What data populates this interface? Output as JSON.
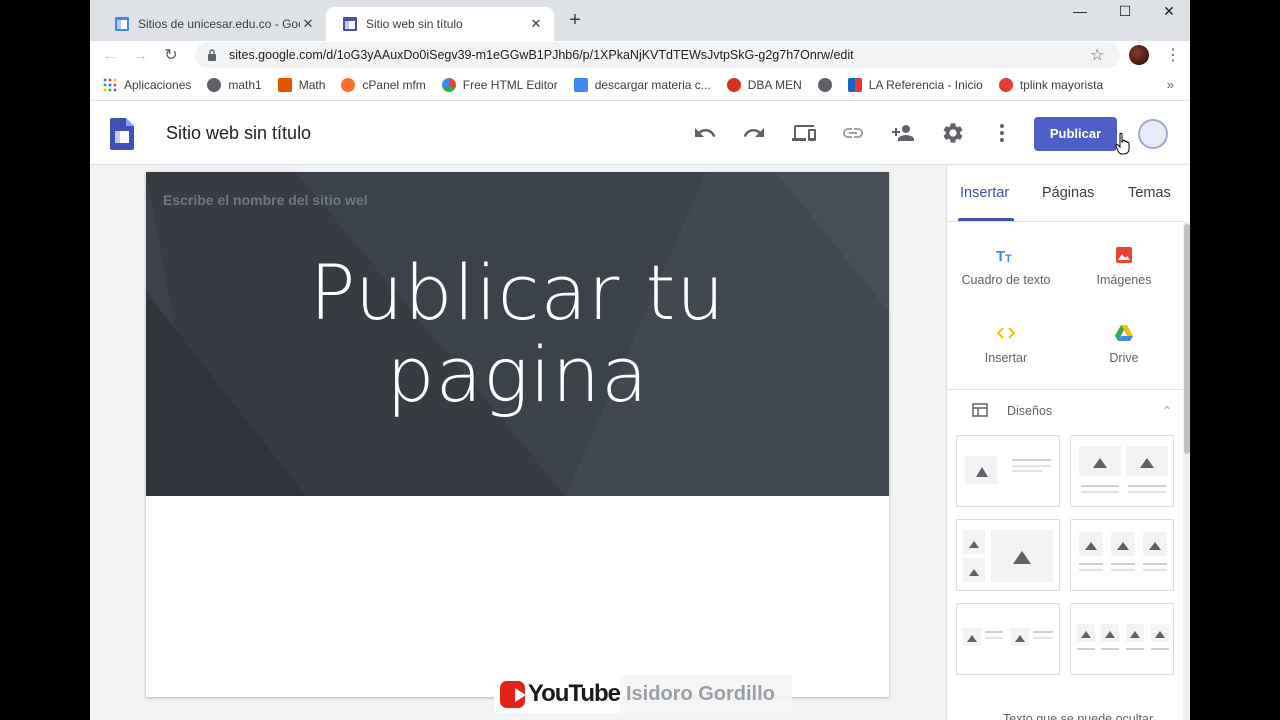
{
  "browser": {
    "tabs": [
      {
        "title": "Sitios de unicesar.edu.co - Goog",
        "active": false
      },
      {
        "title": "Sitio web sin título",
        "active": true
      }
    ],
    "new_tab": "+",
    "window_controls": {
      "minimize": "—",
      "maximize": "☐",
      "close": "✕"
    },
    "url": "sites.google.com/d/1oG3yAAuxDo0iSegv39-m1eGGwB1PJhb6/p/1XPkaNjKVTdTEWsJvtpSkG-g2g7h7Onrw/edit",
    "bookmarks": [
      {
        "label": "Aplicaciones",
        "color": "#1a73e8"
      },
      {
        "label": "math1",
        "color": "#5f6368"
      },
      {
        "label": "Math",
        "color": "#e65100"
      },
      {
        "label": "cPanel mfm",
        "color": "#ff6c2c"
      },
      {
        "label": "Free HTML Editor",
        "color": "#34a853"
      },
      {
        "label": "descargar materia c...",
        "color": "#4285f4"
      },
      {
        "label": "DBA MEN",
        "color": "#d93025"
      },
      {
        "label": "",
        "color": "#5f6368"
      },
      {
        "label": "LA Referencia - Inicio",
        "color": "#1565c0"
      },
      {
        "label": "tplink mayorista",
        "color": "#e53935"
      }
    ],
    "bookmarks_more": "»"
  },
  "sites": {
    "title": "Sitio web sin título",
    "publish_label": "Publicar",
    "colors": {
      "accent": "#3f51b5",
      "publish": "#4f5fc5",
      "banner": "#3b4249"
    }
  },
  "canvas": {
    "site_name_placeholder": "Escribe el nombre del sitio wel",
    "hero_line1": "Publicar tu",
    "hero_line2": "pagina"
  },
  "panel": {
    "tabs": [
      "Insertar",
      "Páginas",
      "Temas"
    ],
    "insert_items": [
      {
        "label": "Cuadro de texto",
        "icon": "text-box-icon"
      },
      {
        "label": "Imágenes",
        "icon": "image-icon"
      },
      {
        "label": "Insertar",
        "icon": "embed-icon"
      },
      {
        "label": "Drive",
        "icon": "drive-icon"
      }
    ],
    "layouts_label": "Diseños",
    "bottom_text": "Texto que se puede ocultar"
  },
  "watermark": {
    "brand": "YouTube",
    "channel": "Isidoro Gordillo"
  }
}
